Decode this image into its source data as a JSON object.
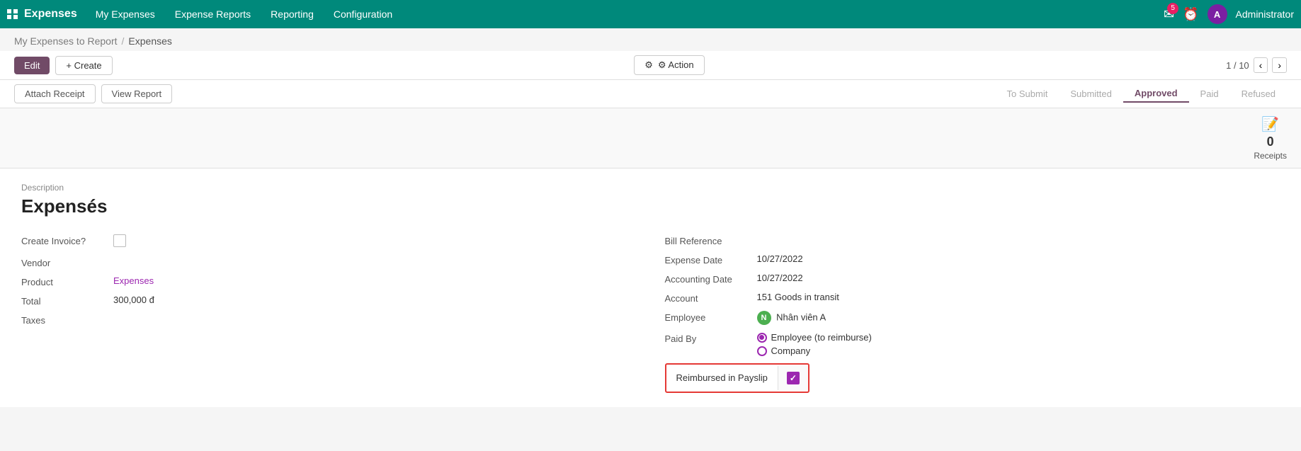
{
  "app": {
    "name": "Expenses",
    "nav_items": [
      "My Expenses",
      "Expense Reports",
      "Reporting",
      "Configuration"
    ],
    "user": "Administrator",
    "user_initial": "A",
    "notification_count": "5"
  },
  "breadcrumb": {
    "parent": "My Expenses to Report",
    "separator": "/",
    "current": "Expenses"
  },
  "toolbar": {
    "edit_label": "Edit",
    "create_label": "+ Create",
    "action_label": "⚙ Action",
    "page_current": "1",
    "page_total": "10",
    "page_display": "1 / 10"
  },
  "sub_toolbar": {
    "attach_receipt_label": "Attach Receipt",
    "view_report_label": "View Report"
  },
  "status": {
    "items": [
      "To Submit",
      "Submitted",
      "Approved",
      "Paid",
      "Refused"
    ],
    "active": "Approved"
  },
  "receipts": {
    "count": "0",
    "label": "Receipts"
  },
  "form": {
    "description_label": "Description",
    "title": "Expensés",
    "fields_left": {
      "create_invoice_label": "Create Invoice?",
      "vendor_label": "Vendor",
      "product_label": "Product",
      "product_value": "Expenses",
      "total_label": "Total",
      "total_value": "300,000 đ",
      "taxes_label": "Taxes"
    },
    "fields_right": {
      "bill_reference_label": "Bill Reference",
      "expense_date_label": "Expense Date",
      "expense_date_value": "10/27/2022",
      "accounting_date_label": "Accounting Date",
      "accounting_date_value": "10/27/2022",
      "account_label": "Account",
      "account_value": "151 Goods in transit",
      "employee_label": "Employee",
      "employee_value": "Nhân viên A",
      "employee_initial": "N",
      "paid_by_label": "Paid By",
      "paid_by_option1": "Employee (to reimburse)",
      "paid_by_option2": "Company",
      "reimbursed_label": "Reimbursed in Payslip"
    }
  }
}
